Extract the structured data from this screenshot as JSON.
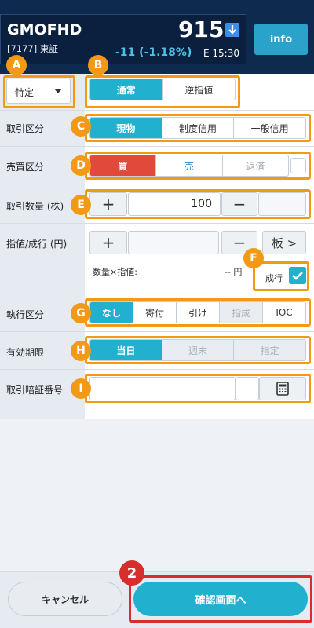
{
  "header": {
    "symbol": "GMOFHD",
    "code_market": "[7177] 東証",
    "price": "915",
    "change": "-11 (-1.18%)",
    "time": "E 15:30",
    "info_label": "info"
  },
  "badges": [
    "A",
    "B",
    "C",
    "D",
    "E",
    "F",
    "G",
    "H",
    "I",
    "2"
  ],
  "account": {
    "selected": "特定"
  },
  "order_type": {
    "options": [
      "通常",
      "逆指値"
    ],
    "selected": "通常"
  },
  "rows": {
    "trade_class": {
      "label": "取引区分",
      "options": [
        "現物",
        "制度信用",
        "一般信用"
      ],
      "selected": "現物"
    },
    "side": {
      "label": "売買区分",
      "options": [
        "買",
        "売",
        "返済"
      ],
      "selected": "買"
    },
    "quantity": {
      "label": "取引数量 (株)",
      "plus": "+",
      "minus": "−",
      "value": "100"
    },
    "price": {
      "label": "指値/成行 (円)",
      "plus": "+",
      "minus": "−",
      "board": "板 >",
      "calc_label": "数量×指値:",
      "calc_value": "-- 円",
      "market_label": "成行"
    },
    "execution": {
      "label": "執行区分",
      "options": [
        "なし",
        "寄付",
        "引け",
        "指成",
        "IOC"
      ],
      "selected": "なし"
    },
    "validity": {
      "label": "有効期限",
      "options": [
        "当日",
        "週末",
        "指定"
      ],
      "selected": "当日"
    },
    "pin": {
      "label": "取引暗証番号",
      "value": ""
    }
  },
  "footer": {
    "cancel": "キャンセル",
    "confirm": "確認画面へ"
  },
  "colors": {
    "accent": "#21b0cd",
    "buy": "#e14a3b",
    "highlight": "#f29a16",
    "header": "#0e2a4f"
  }
}
